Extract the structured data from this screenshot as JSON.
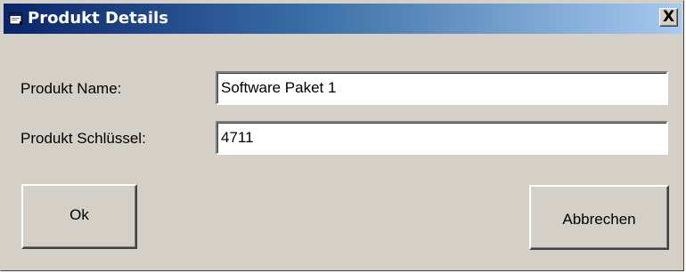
{
  "window": {
    "title": "Produkt Details",
    "close_label": "X"
  },
  "form": {
    "name_label": "Produkt Name:",
    "name_value": "Software Paket 1",
    "key_label": "Produkt Schlüssel:",
    "key_value": "4711"
  },
  "buttons": {
    "ok_label": "Ok",
    "cancel_label": "Abbrechen"
  },
  "icons": {
    "title_icon": "application-window-icon",
    "close_icon": "close-icon"
  },
  "colors": {
    "titlebar_start": "#0a246a",
    "titlebar_end": "#a6caf0",
    "dialog_background": "#d4d0c8"
  }
}
